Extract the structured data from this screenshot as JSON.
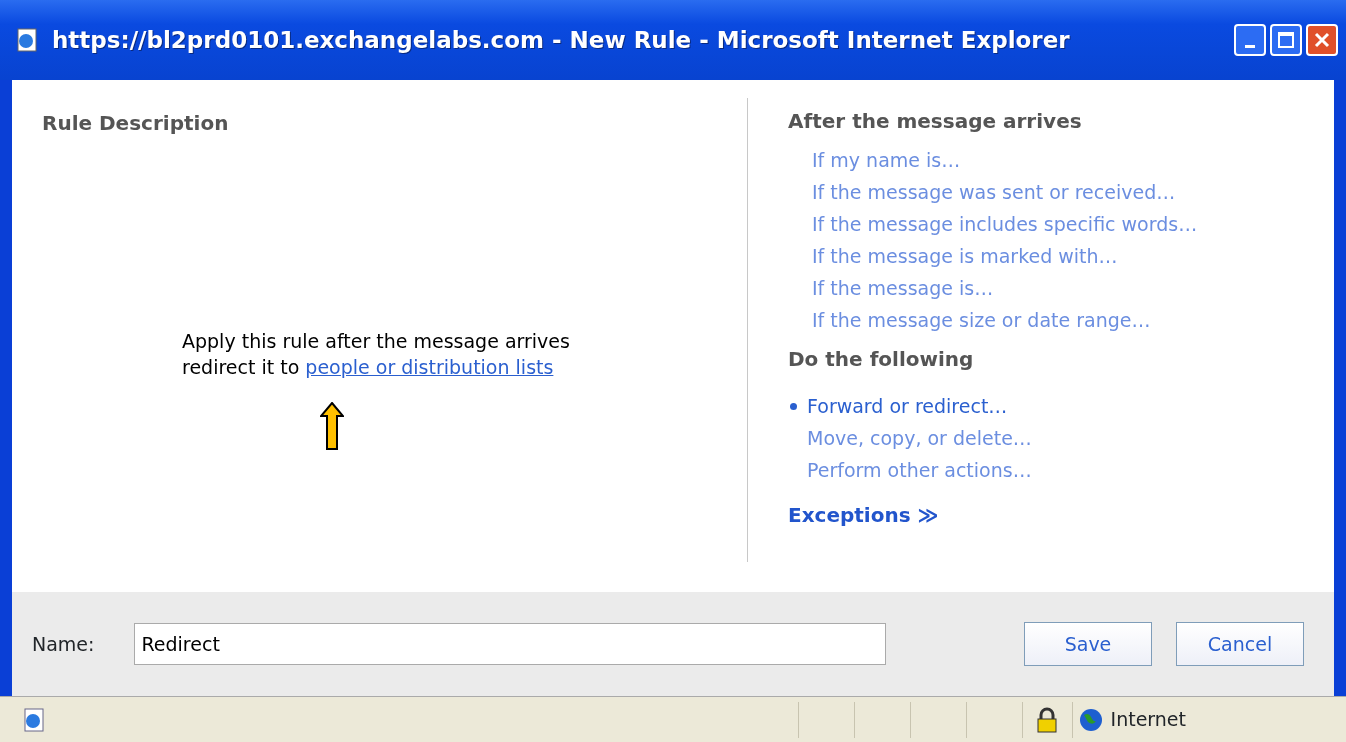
{
  "window": {
    "title": "https://bl2prd0101.exchangelabs.com - New Rule - Microsoft Internet Explorer"
  },
  "rule_description": {
    "heading": "Rule Description",
    "line_1": "Apply this rule after the message arrives",
    "line_2_prefix": "redirect it to",
    "line_2_link": "people or distribution lists"
  },
  "conditions": {
    "heading": "After the message arrives",
    "items": [
      {
        "label": "If my name is…"
      },
      {
        "label": "If the message was sent or received…"
      },
      {
        "label": "If the message includes specific words…"
      },
      {
        "label": "If the message is marked with…"
      },
      {
        "label": "If the message is…"
      },
      {
        "label": "If the message size or date range…"
      }
    ]
  },
  "actions": {
    "heading": "Do the following",
    "items": [
      {
        "label": "Forward or redirect…",
        "selected": true
      },
      {
        "label": "Move, copy, or delete…",
        "selected": false
      },
      {
        "label": "Perform other actions…",
        "selected": false
      }
    ]
  },
  "exceptions": {
    "label": "Exceptions",
    "icon": "≫"
  },
  "footer": {
    "name_label": "Name:",
    "name_value": "Redirect",
    "buttons": [
      "Save",
      "Cancel"
    ]
  },
  "status_bar": {
    "zone": "Internet"
  }
}
